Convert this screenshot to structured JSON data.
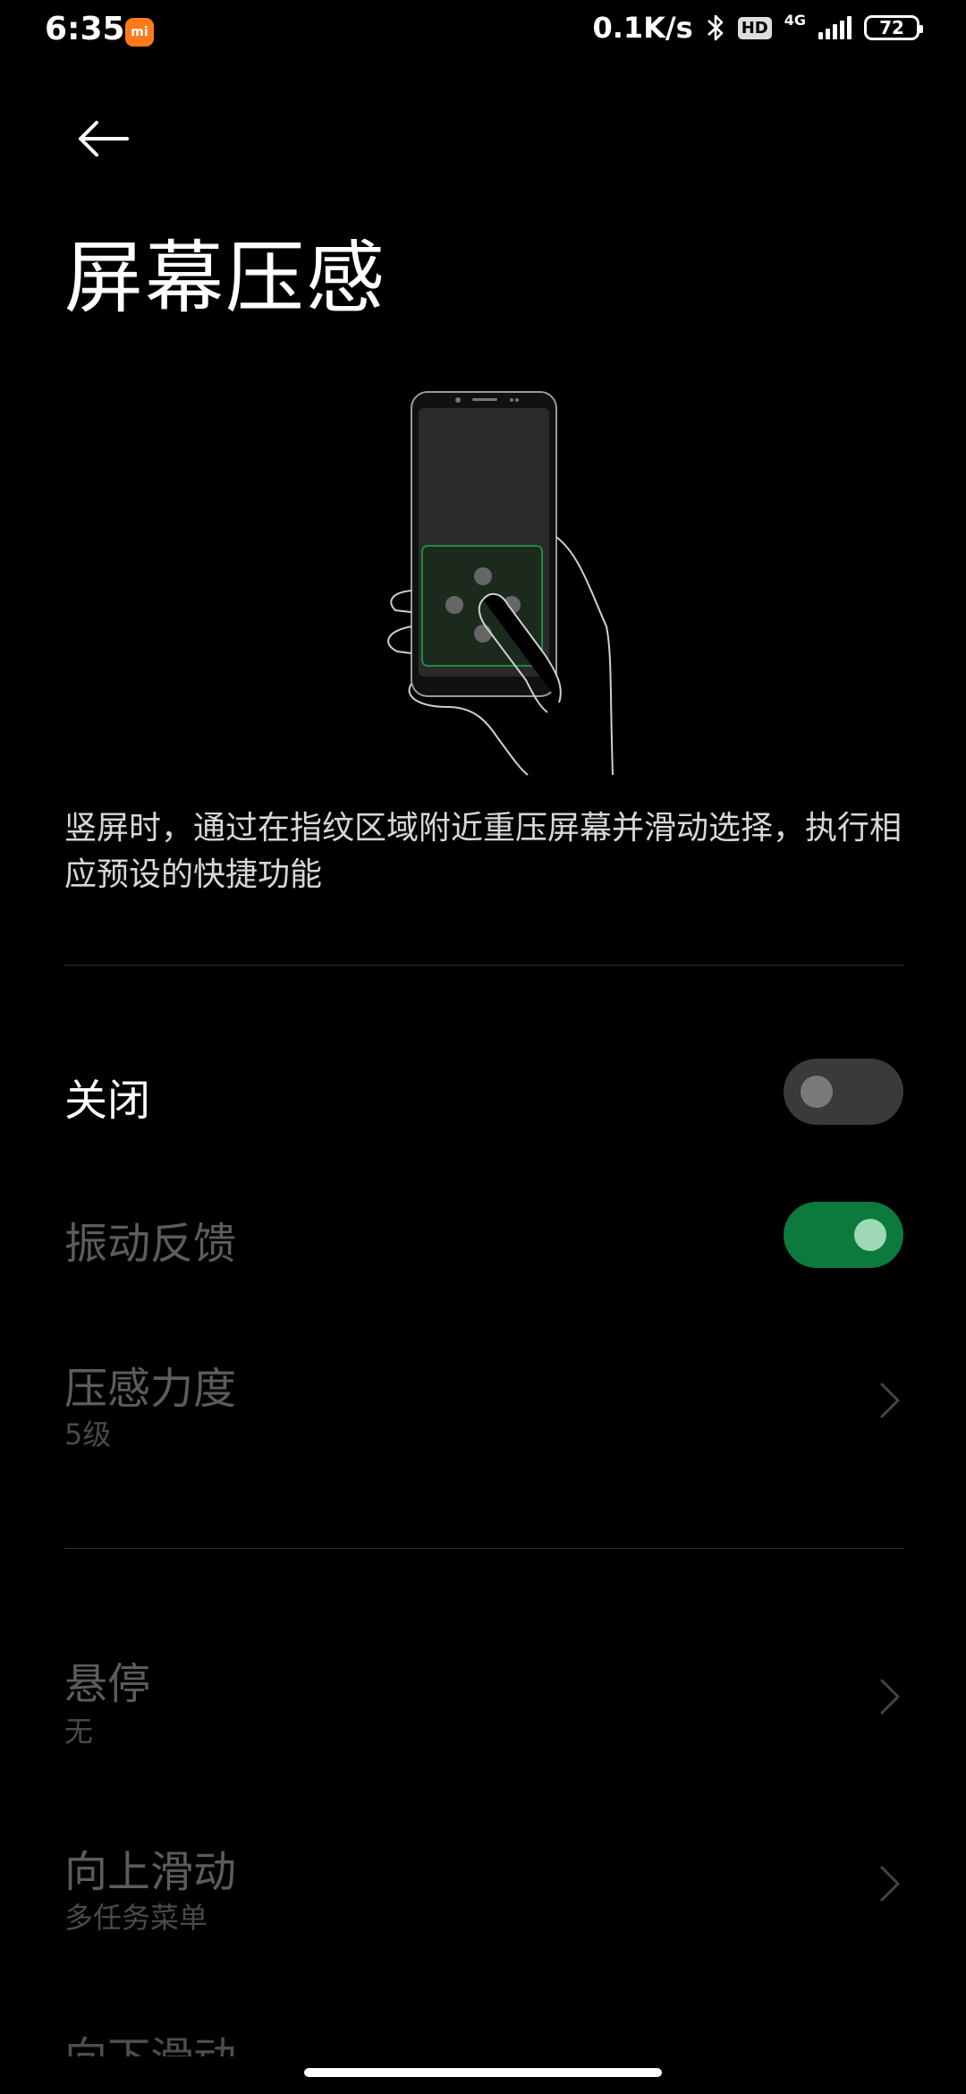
{
  "status_bar": {
    "time": "6:35",
    "net_speed": "0.1K/s",
    "hd": "HD",
    "net_type": "4G",
    "battery": "72"
  },
  "header": {
    "back_icon": "arrow-left-icon",
    "title": "屏幕压感"
  },
  "description": "竖屏时，通过在指纹区域附近重压屏幕并滑动选择，执行相应预设的快捷功能",
  "settings": {
    "master": {
      "label": "关闭",
      "toggle": "off"
    },
    "vibration": {
      "label": "振动反馈",
      "toggle": "on"
    },
    "force": {
      "label": "压感力度",
      "value": "5级"
    },
    "hover": {
      "label": "悬停",
      "value": "无"
    },
    "swipe_up": {
      "label": "向上滑动",
      "value": "多任务菜单"
    },
    "swipe_down": {
      "label": "向下滑动"
    }
  },
  "colors": {
    "background": "#000000",
    "toggle_on": "#0c7a3d",
    "toggle_off": "#3a3a3a",
    "dim_text": "#5c5c5c"
  }
}
